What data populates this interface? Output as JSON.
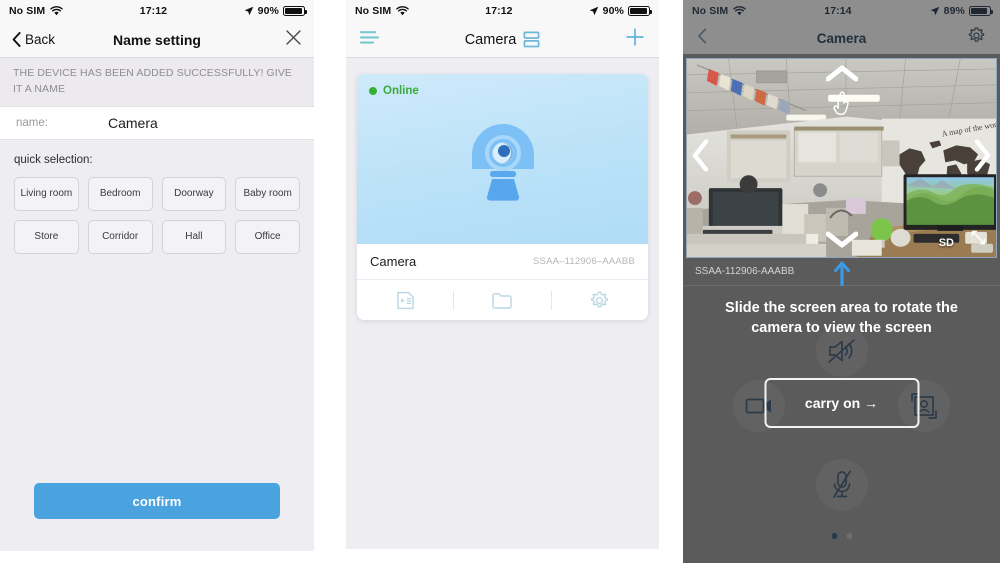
{
  "panel1": {
    "status": {
      "carrier": "No SIM",
      "wifi_icon": "wifi-icon",
      "time": "17:12",
      "location_icon": "location-arrow-icon",
      "battery": "90%"
    },
    "nav": {
      "back_label": "Back",
      "title": "Name setting",
      "close_icon": "close-icon",
      "back_icon": "chevron-left-icon"
    },
    "hint": "THE DEVICE HAS BEEN ADDED SUCCESSFULLY! GIVE IT A NAME",
    "name_row": {
      "label": "name:",
      "value": "Camera"
    },
    "quick_selection": {
      "title": "quick selection:",
      "options": [
        "Living room",
        "Bedroom",
        "Doorway",
        "Baby room",
        "Store",
        "Corridor",
        "Hall",
        "Office"
      ]
    },
    "confirm_label": "confirm",
    "accent_color": "#4aa3df"
  },
  "panel2": {
    "status": {
      "carrier": "No SIM",
      "wifi_icon": "wifi-icon",
      "time": "17:12",
      "location_icon": "location-arrow-icon",
      "battery": "90%"
    },
    "nav": {
      "menu_icon": "hamburger-menu-icon",
      "title": "Camera",
      "layout_icon": "list-layout-toggle-icon",
      "add_icon": "plus-icon"
    },
    "card": {
      "status_label": "Online",
      "status_color": "#35b035",
      "preview_icon": "dome-camera-icon",
      "device_name": "Camera",
      "serial": "SSAA–112906–AAABB",
      "actions": [
        {
          "icon": "playback-list-icon",
          "name": "playback"
        },
        {
          "icon": "folder-icon",
          "name": "files"
        },
        {
          "icon": "gear-icon",
          "name": "settings"
        }
      ]
    }
  },
  "panel3": {
    "status": {
      "carrier": "No SIM",
      "wifi_icon": "wifi-icon",
      "time": "17:14",
      "location_icon": "location-arrow-icon",
      "battery": "89%"
    },
    "nav": {
      "back_icon": "chevron-left-icon",
      "title": "Camera",
      "gear_icon": "gear-icon"
    },
    "video": {
      "pan_up_icon": "chevron-up-icon",
      "pan_down_icon": "chevron-down-icon",
      "pan_left_icon": "chevron-left-icon",
      "pan_right_icon": "chevron-right-icon",
      "hand_icon": "hand-pointer-icon",
      "quality_badge": "SD",
      "expand_icon": "fullscreen-expand-icon",
      "scene_description": "office interior with world map wall decal"
    },
    "serial": "SSAA-112906-AAABB",
    "pointer_arrow_icon": "arrow-up-icon",
    "pointer_arrow_color": "#3d9ae2",
    "tutorial_text": "Slide the screen area to rotate the camera to view the screen",
    "carry_on_label": "carry on →",
    "controls": [
      {
        "icon": "speaker-muted-icon",
        "name": "speaker-toggle"
      },
      {
        "icon": "video-record-icon",
        "name": "record"
      },
      {
        "icon": "snapshot-icon",
        "name": "snapshot"
      },
      {
        "icon": "microphone-muted-icon",
        "name": "microphone-toggle"
      }
    ],
    "page_dots": {
      "count": 2,
      "active": 0
    }
  }
}
